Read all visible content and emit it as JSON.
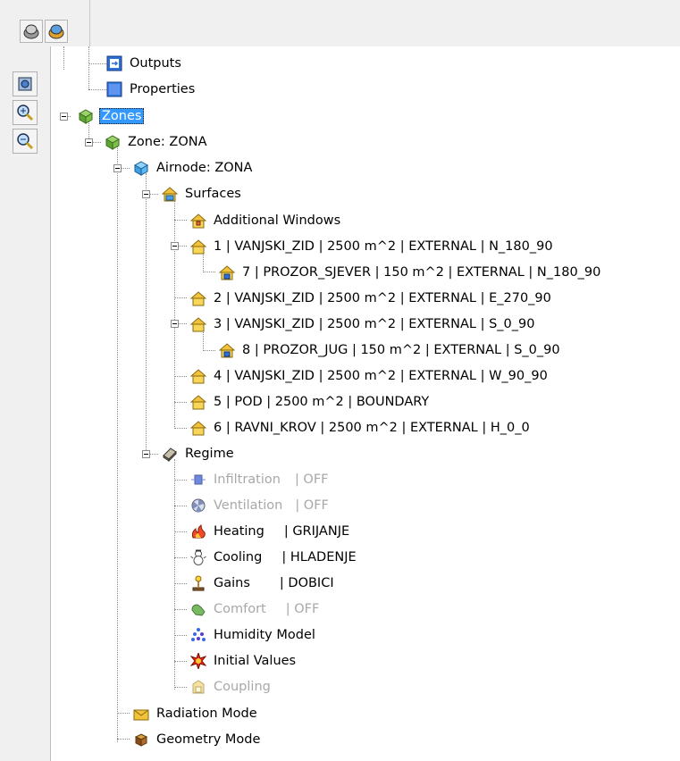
{
  "colors": {
    "selection": "#3399ff",
    "disabled_text": "#a8a8a8",
    "tree_lines": "#8a8a8a"
  },
  "toolbar_top": {
    "icons": [
      "grey-sphere-icon",
      "colored-sphere-icon"
    ]
  },
  "toolbar_left": {
    "icons": [
      "cube-zoom-icon",
      "zoom-in-icon",
      "zoom-out-icon"
    ]
  },
  "tree": {
    "outputs": "Outputs",
    "properties": "Properties",
    "zones": "Zones",
    "zone": "Zone: ZONA",
    "airnode": "Airnode: ZONA",
    "surfaces": "Surfaces",
    "additional_windows": "Additional Windows",
    "s1": "1  |  VANJSKI_ZID  |  2500 m^2  |  EXTERNAL  |  N_180_90",
    "s7": "7  |  PROZOR_SJEVER  |  150 m^2  |  EXTERNAL  |  N_180_90",
    "s2": "2  |  VANJSKI_ZID  |  2500 m^2  |  EXTERNAL  |  E_270_90",
    "s3": "3  |  VANJSKI_ZID  |  2500 m^2  |  EXTERNAL  |  S_0_90",
    "s8": "8  |  PROZOR_JUG  |  150 m^2  |  EXTERNAL  |  S_0_90",
    "s4": "4  |  VANJSKI_ZID  |  2500 m^2  |  EXTERNAL  |  W_90_90",
    "s5": "5  |  POD  |  2500 m^2  |  BOUNDARY",
    "s6": "6  |  RAVNI_KROV  |  2500 m^2  |  EXTERNAL  |  H_0_0",
    "regime": "Regime",
    "infiltration": {
      "label": "Infiltration",
      "value": "|  OFF"
    },
    "ventilation": {
      "label": "Ventilation",
      "value": "|  OFF"
    },
    "heating": {
      "label": "Heating",
      "value": "|  GRIJANJE"
    },
    "cooling": {
      "label": "Cooling",
      "value": "|  HLADENJE"
    },
    "gains": {
      "label": "Gains",
      "value": "|  DOBICI"
    },
    "comfort": {
      "label": "Comfort",
      "value": "|  OFF"
    },
    "humidity_model": "Humidity Model",
    "initial_values": "Initial Values",
    "coupling": "Coupling",
    "radiation_mode": "Radiation Mode",
    "geometry_mode": "Geometry Mode"
  }
}
